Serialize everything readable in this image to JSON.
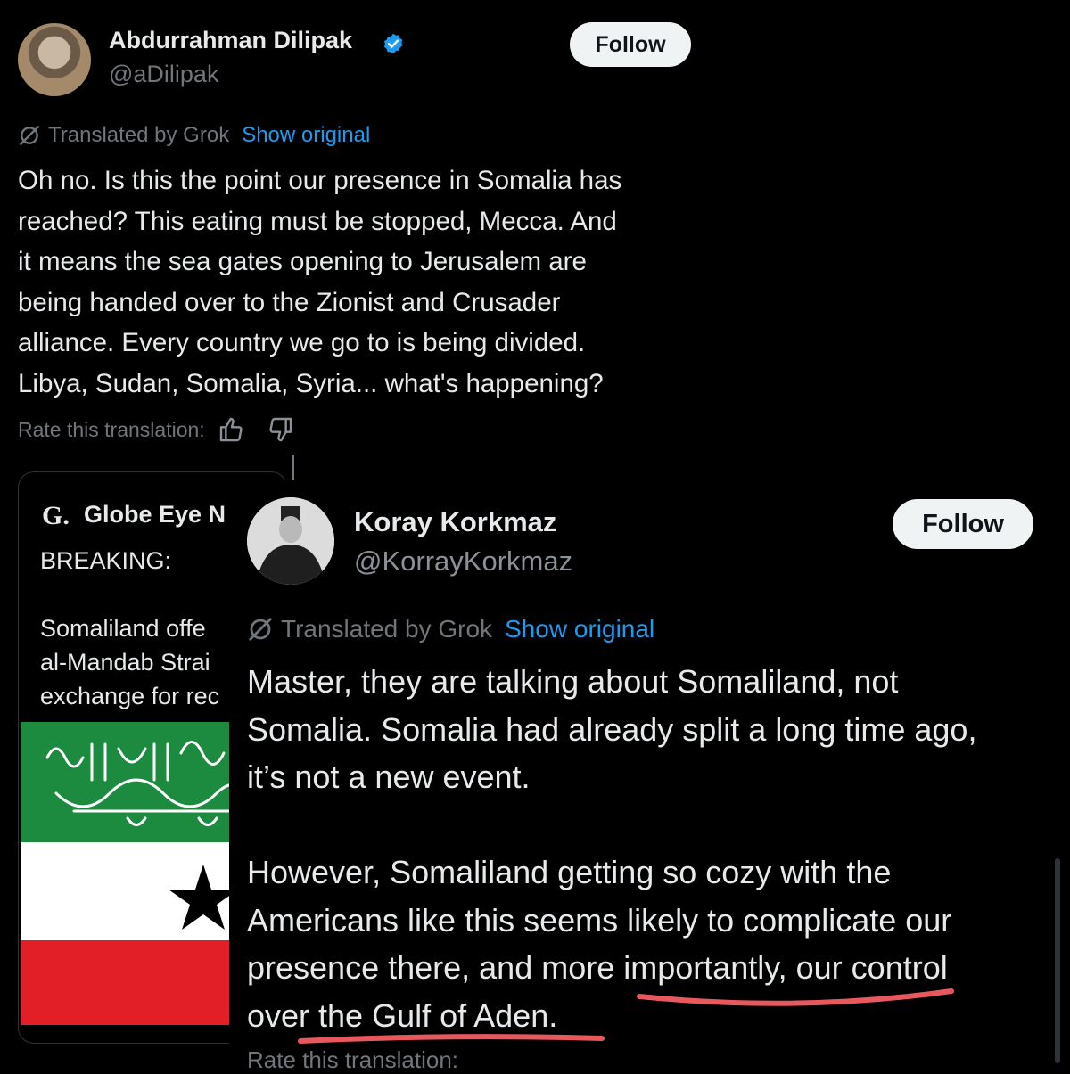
{
  "post1": {
    "display_name": "Abdurrahman Dilipak",
    "handle": "@aDilipak",
    "follow_label": "Follow",
    "translated_by": "Translated by Grok",
    "show_original": "Show original",
    "text": "Oh no. Is this the point our presence in Somalia has\nreached? This eating must be stopped, Mecca. And\nit means the sea gates opening to Jerusalem are\nbeing handed over to the Zionist and Crusader\nalliance. Every country we go to is being divided.\nLibya, Sudan, Somalia, Syria... what's happening?",
    "rate_label": "Rate this translation:",
    "icons": {
      "verified": "verified-badge-icon",
      "grok": "grok-icon",
      "up": "thumbs-up-icon",
      "down": "thumbs-down-icon"
    },
    "quote": {
      "logo": "G.",
      "source_name": "Globe Eye N",
      "text": "BREAKING:\n\nSomaliland offe\nal-Mandab Strai\nexchange for rec"
    }
  },
  "post2": {
    "display_name": "Koray Korkmaz",
    "handle": "@KorrayKorkmaz",
    "follow_label": "Follow",
    "translated_by": "Translated by Grok",
    "show_original": "Show original",
    "text": "Master, they are talking about Somaliland, not\nSomalia. Somalia had already split a long time ago,\nit’s not a new event.\n\nHowever, Somaliland getting so cozy with the\nAmericans like this seems likely to complicate our\npresence there, and more importantly, our control\nover the Gulf of Aden.",
    "rate_label": "Rate this translation:"
  },
  "colors": {
    "background": "#000000",
    "text": "#e7e9ea",
    "muted": "#71767b",
    "link": "#1d9bf0",
    "verified": "#1d9bf0",
    "underline": "#e8595f",
    "flag_green": "#1c8a3f",
    "flag_red": "#e21f26"
  }
}
